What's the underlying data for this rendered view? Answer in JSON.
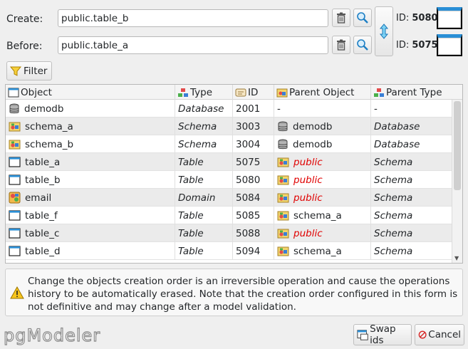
{
  "form": {
    "create_label": "Create:",
    "create_value": "public.table_b",
    "before_label": "Before:",
    "before_value": "public.table_a",
    "create_id_label": "ID:",
    "create_id": "5080",
    "before_id_label": "ID:",
    "before_id": "5075",
    "filter_label": "Filter"
  },
  "table": {
    "columns": [
      "Object",
      "Type",
      "ID",
      "Parent Object",
      "Parent Type"
    ],
    "rows": [
      {
        "icon": "database-icon",
        "object": "demodb",
        "type": "Database",
        "id": "2001",
        "parent_icon": "",
        "parent": "-",
        "parent_type": "-",
        "parent_red": false
      },
      {
        "icon": "schema-icon",
        "object": "schema_a",
        "type": "Schema",
        "id": "3003",
        "parent_icon": "database-icon",
        "parent": "demodb",
        "parent_type": "Database",
        "parent_red": false
      },
      {
        "icon": "schema-icon",
        "object": "schema_b",
        "type": "Schema",
        "id": "3004",
        "parent_icon": "database-icon",
        "parent": "demodb",
        "parent_type": "Database",
        "parent_red": false
      },
      {
        "icon": "table-icon",
        "object": "table_a",
        "type": "Table",
        "id": "5075",
        "parent_icon": "schema-icon",
        "parent": "public",
        "parent_type": "Schema",
        "parent_red": true
      },
      {
        "icon": "table-icon",
        "object": "table_b",
        "type": "Table",
        "id": "5080",
        "parent_icon": "schema-icon",
        "parent": "public",
        "parent_type": "Schema",
        "parent_red": true
      },
      {
        "icon": "domain-icon",
        "object": "email",
        "type": "Domain",
        "id": "5084",
        "parent_icon": "schema-icon",
        "parent": "public",
        "parent_type": "Schema",
        "parent_red": true
      },
      {
        "icon": "table-icon",
        "object": "table_f",
        "type": "Table",
        "id": "5085",
        "parent_icon": "schema-icon",
        "parent": "schema_a",
        "parent_type": "Schema",
        "parent_red": false
      },
      {
        "icon": "table-icon",
        "object": "table_c",
        "type": "Table",
        "id": "5088",
        "parent_icon": "schema-icon",
        "parent": "public",
        "parent_type": "Schema",
        "parent_red": true
      },
      {
        "icon": "table-icon",
        "object": "table_d",
        "type": "Table",
        "id": "5094",
        "parent_icon": "schema-icon",
        "parent": "schema_a",
        "parent_type": "Schema",
        "parent_red": false
      }
    ]
  },
  "message": "Change the objects creation order is an irreversible operation and cause the operations history to be automatically erased. Note that the creation order configured in this form is not definitive and may change after a model validation.",
  "footer": {
    "logo": "pgModeler",
    "swap_label": "Swap ids",
    "cancel_label": "Cancel"
  },
  "colors": {
    "accent_blue": "#2a8fd6",
    "red_text": "#e00000",
    "background": "#efefef"
  }
}
